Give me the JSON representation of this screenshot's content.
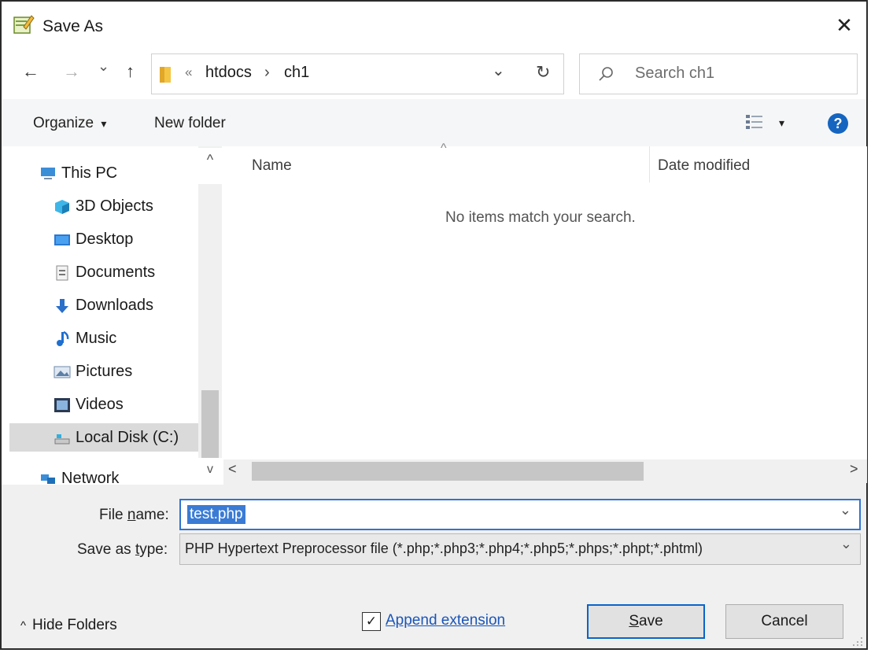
{
  "window": {
    "title": "Save As",
    "close": "✕"
  },
  "nav": {
    "back": "←",
    "forward": "→",
    "recent": "⌄",
    "up": "↑",
    "breadcrumb_sep1": "«",
    "crumb1": "htdocs",
    "breadcrumb_sep2": "›",
    "crumb2": "ch1",
    "address_dropdown": "⌄",
    "refresh": "↻",
    "search_placeholder": "Search ch1"
  },
  "toolbar": {
    "organize": "Organize",
    "organize_arrow": "▾",
    "new_folder": "New folder",
    "view_arrow": "▾",
    "help": "?"
  },
  "tree": {
    "items": [
      {
        "label": "This PC",
        "icon": "computer-icon"
      },
      {
        "label": "3D Objects",
        "icon": "cube-icon"
      },
      {
        "label": "Desktop",
        "icon": "desktop-icon"
      },
      {
        "label": "Documents",
        "icon": "document-icon"
      },
      {
        "label": "Downloads",
        "icon": "download-icon"
      },
      {
        "label": "Music",
        "icon": "music-icon"
      },
      {
        "label": "Pictures",
        "icon": "pictures-icon"
      },
      {
        "label": "Videos",
        "icon": "videos-icon"
      },
      {
        "label": "Local Disk (C:)",
        "icon": "disk-icon"
      },
      {
        "label": "Network",
        "icon": "network-icon"
      }
    ],
    "scroll_up": "^",
    "scroll_down": "v"
  },
  "list": {
    "sort_caret": "^",
    "col_name": "Name",
    "col_date": "Date modified",
    "empty": "No items match your search.",
    "scroll_left": "<",
    "scroll_right": ">"
  },
  "form": {
    "file_name_label_pre": "File ",
    "file_name_label_ul": "n",
    "file_name_label_post": "ame:",
    "file_name_value": "test.php",
    "save_type_label_pre": "Save as ",
    "save_type_label_ul": "t",
    "save_type_label_post": "ype:",
    "save_type_value": "PHP Hypertext Preprocessor file (*.php;*.php3;*.php4;*.php5;*.phps;*.phpt;*.phtml)",
    "dropdown": "⌄"
  },
  "footer": {
    "hide_folders_arrow": "^",
    "hide_folders": "Hide Folders",
    "append_extension": "Append extension",
    "append_checked": "✓",
    "save_ul": "S",
    "save_rest": "ave",
    "cancel": "Cancel"
  },
  "colors": {
    "accent": "#0a64c8",
    "selection": "#3a7bd5",
    "help": "#1565c0"
  }
}
